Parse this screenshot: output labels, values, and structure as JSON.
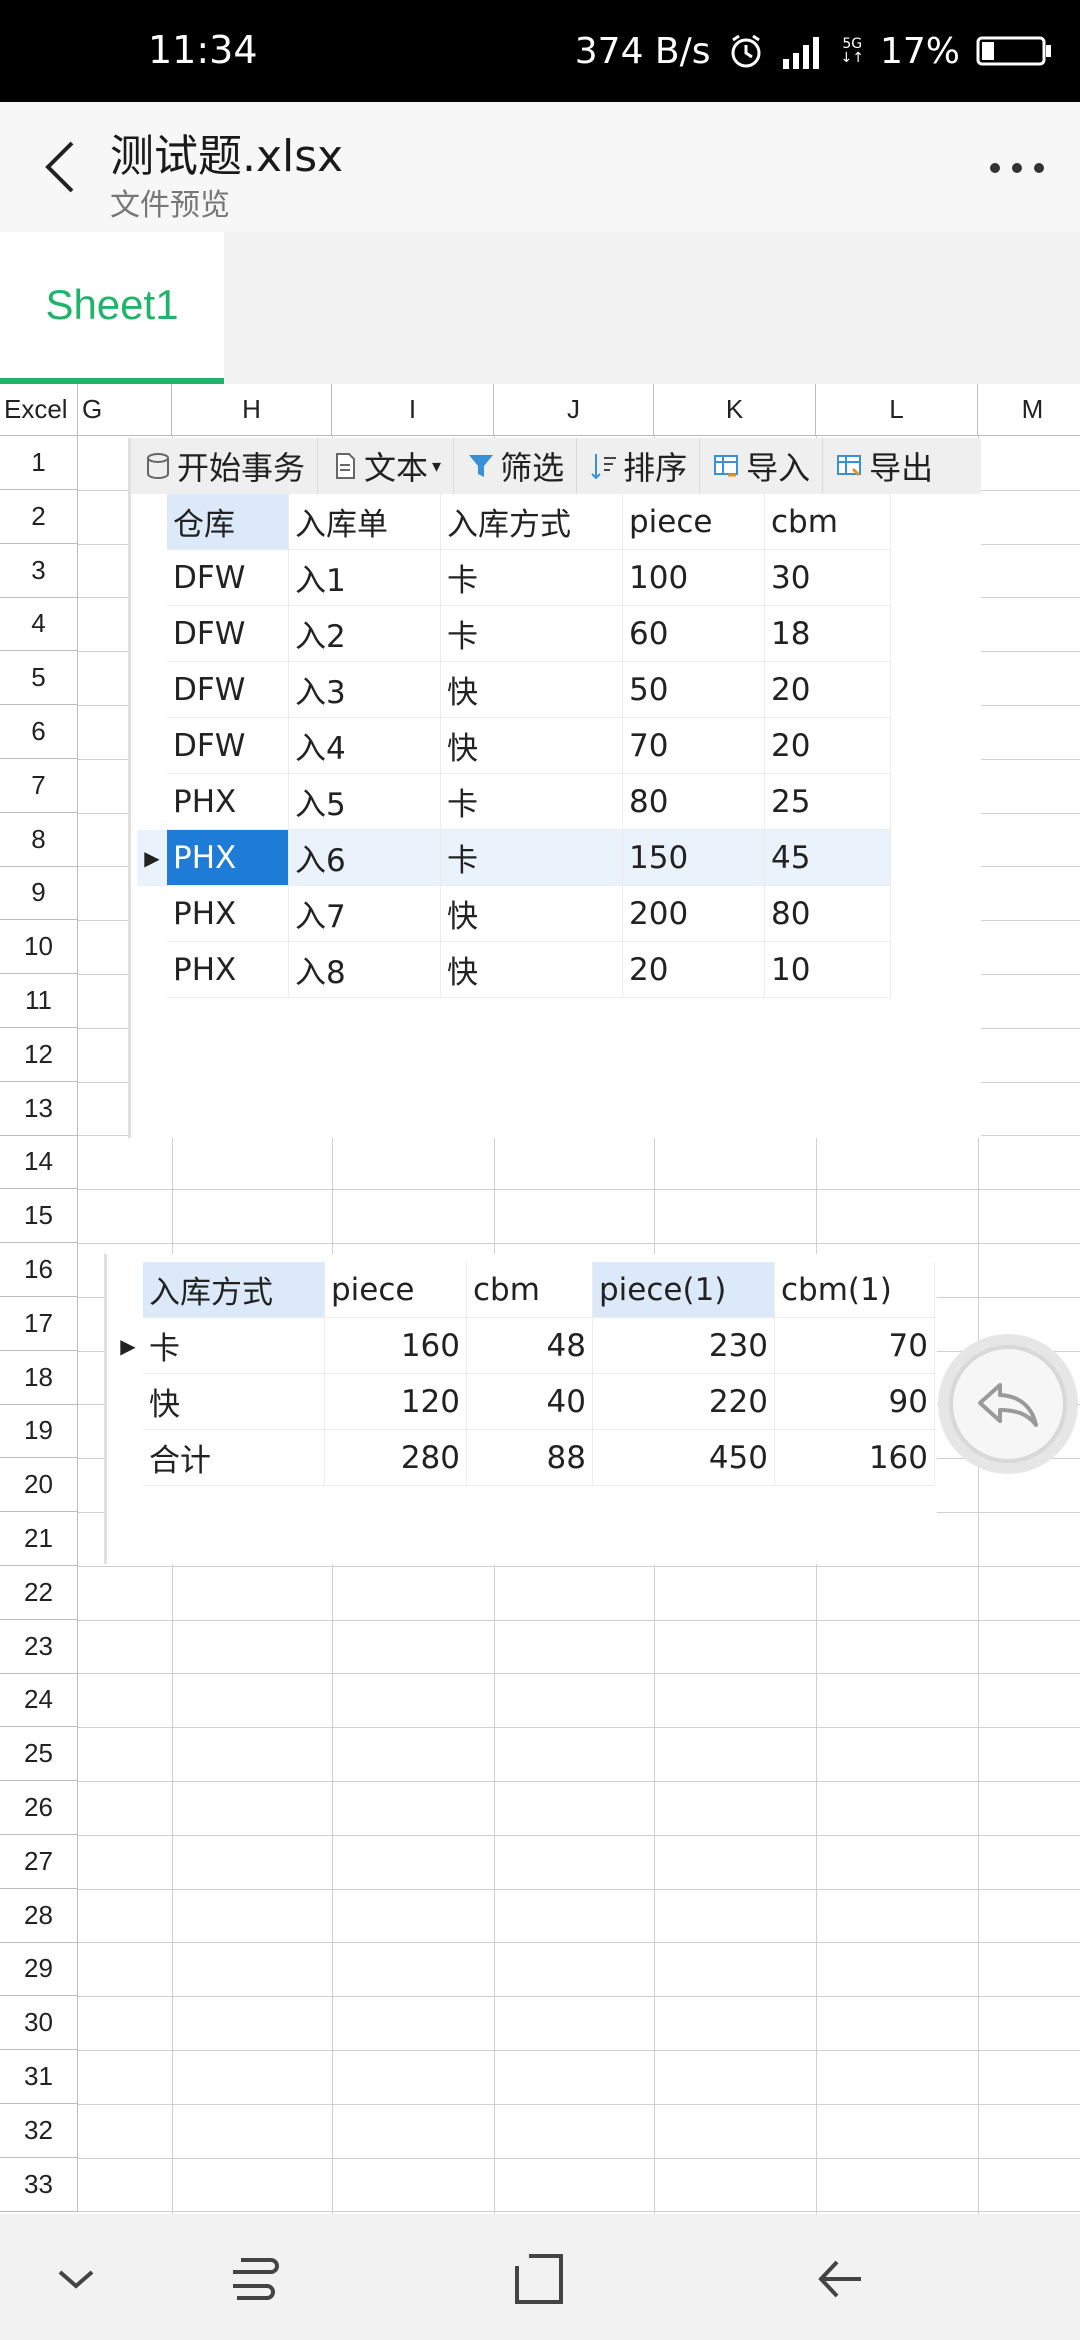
{
  "status_bar": {
    "time": "11:34",
    "net_speed": "374 B/s",
    "net_type": "5G",
    "battery": "17%"
  },
  "app_bar": {
    "title": "测试题.xlsx",
    "subtitle": "文件预览"
  },
  "sheet_tabs": [
    "Sheet1"
  ],
  "grid": {
    "corner": "Excel",
    "columns": [
      "G",
      "H",
      "I",
      "J",
      "K",
      "L",
      "M"
    ],
    "rows": [
      "1",
      "2",
      "3",
      "4",
      "5",
      "6",
      "7",
      "8",
      "9",
      "10",
      "11",
      "12",
      "13",
      "14",
      "15",
      "16",
      "17",
      "18",
      "19",
      "20",
      "21",
      "22",
      "23",
      "24",
      "25",
      "26",
      "27",
      "28",
      "29",
      "30",
      "31",
      "32",
      "33"
    ]
  },
  "toolbar": {
    "items": [
      "开始事务",
      "文本",
      "筛选",
      "排序",
      "导入",
      "导出"
    ]
  },
  "table1": {
    "headers": [
      "仓库",
      "入库单",
      "入库方式",
      "piece",
      "cbm"
    ],
    "rows": [
      [
        "DFW",
        "入1",
        "卡",
        "100",
        "30"
      ],
      [
        "DFW",
        "入2",
        "卡",
        "60",
        "18"
      ],
      [
        "DFW",
        "入3",
        "快",
        "50",
        "20"
      ],
      [
        "DFW",
        "入4",
        "快",
        "70",
        "20"
      ],
      [
        "PHX",
        "入5",
        "卡",
        "80",
        "25"
      ],
      [
        "PHX",
        "入6",
        "卡",
        "150",
        "45"
      ],
      [
        "PHX",
        "入7",
        "快",
        "200",
        "80"
      ],
      [
        "PHX",
        "入8",
        "快",
        "20",
        "10"
      ]
    ]
  },
  "table2": {
    "headers": [
      "入库方式",
      "piece",
      "cbm",
      "piece(1)",
      "cbm(1)"
    ],
    "rows": [
      [
        "卡",
        "160",
        "48",
        "230",
        "70"
      ],
      [
        "快",
        "120",
        "40",
        "220",
        "90"
      ],
      [
        "合计",
        "280",
        "88",
        "450",
        "160"
      ]
    ]
  },
  "colors": {
    "accent_green": "#22b36b",
    "selection_blue": "#1e7bd6",
    "header_blue": "#dbe9f8"
  }
}
